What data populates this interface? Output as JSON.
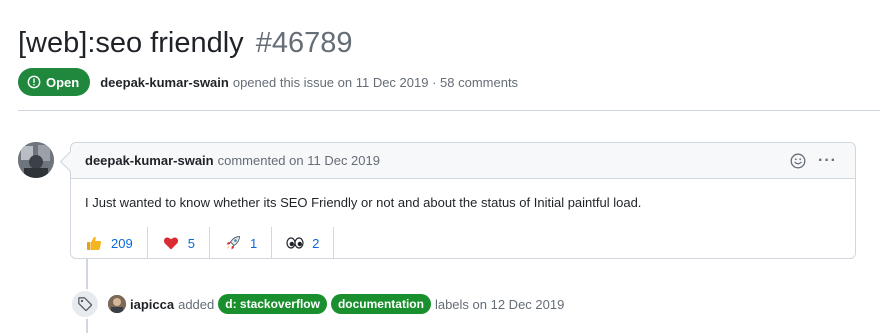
{
  "issue": {
    "title": "[web]:seo friendly",
    "number": "#46789",
    "state": "Open",
    "author": "deepak-kumar-swain",
    "opened_text": "opened this issue on 11 Dec 2019 · 58 comments"
  },
  "comment": {
    "author": "deepak-kumar-swain",
    "commented_text": "commented on 11 Dec 2019",
    "body": "I Just wanted to know whether its SEO Friendly or not and about the status of Initial paintful load.",
    "menu_label": "···",
    "reactions": [
      {
        "icon": "thumbs-up-icon",
        "count": "209"
      },
      {
        "icon": "heart-icon",
        "count": "5"
      },
      {
        "icon": "rocket-icon",
        "count": "1"
      },
      {
        "icon": "eyes-icon",
        "count": "2"
      }
    ]
  },
  "event": {
    "actor": "iapicca",
    "action": "added",
    "labels": [
      {
        "name": "d: stackoverflow",
        "color": "#1a8f2e"
      },
      {
        "name": "documentation",
        "color": "#1a8f2e"
      }
    ],
    "suffix": "labels on 12 Dec 2019"
  },
  "colors": {
    "open_green": "#1f883d",
    "link_blue": "#0969da",
    "border": "#d0d7de"
  }
}
